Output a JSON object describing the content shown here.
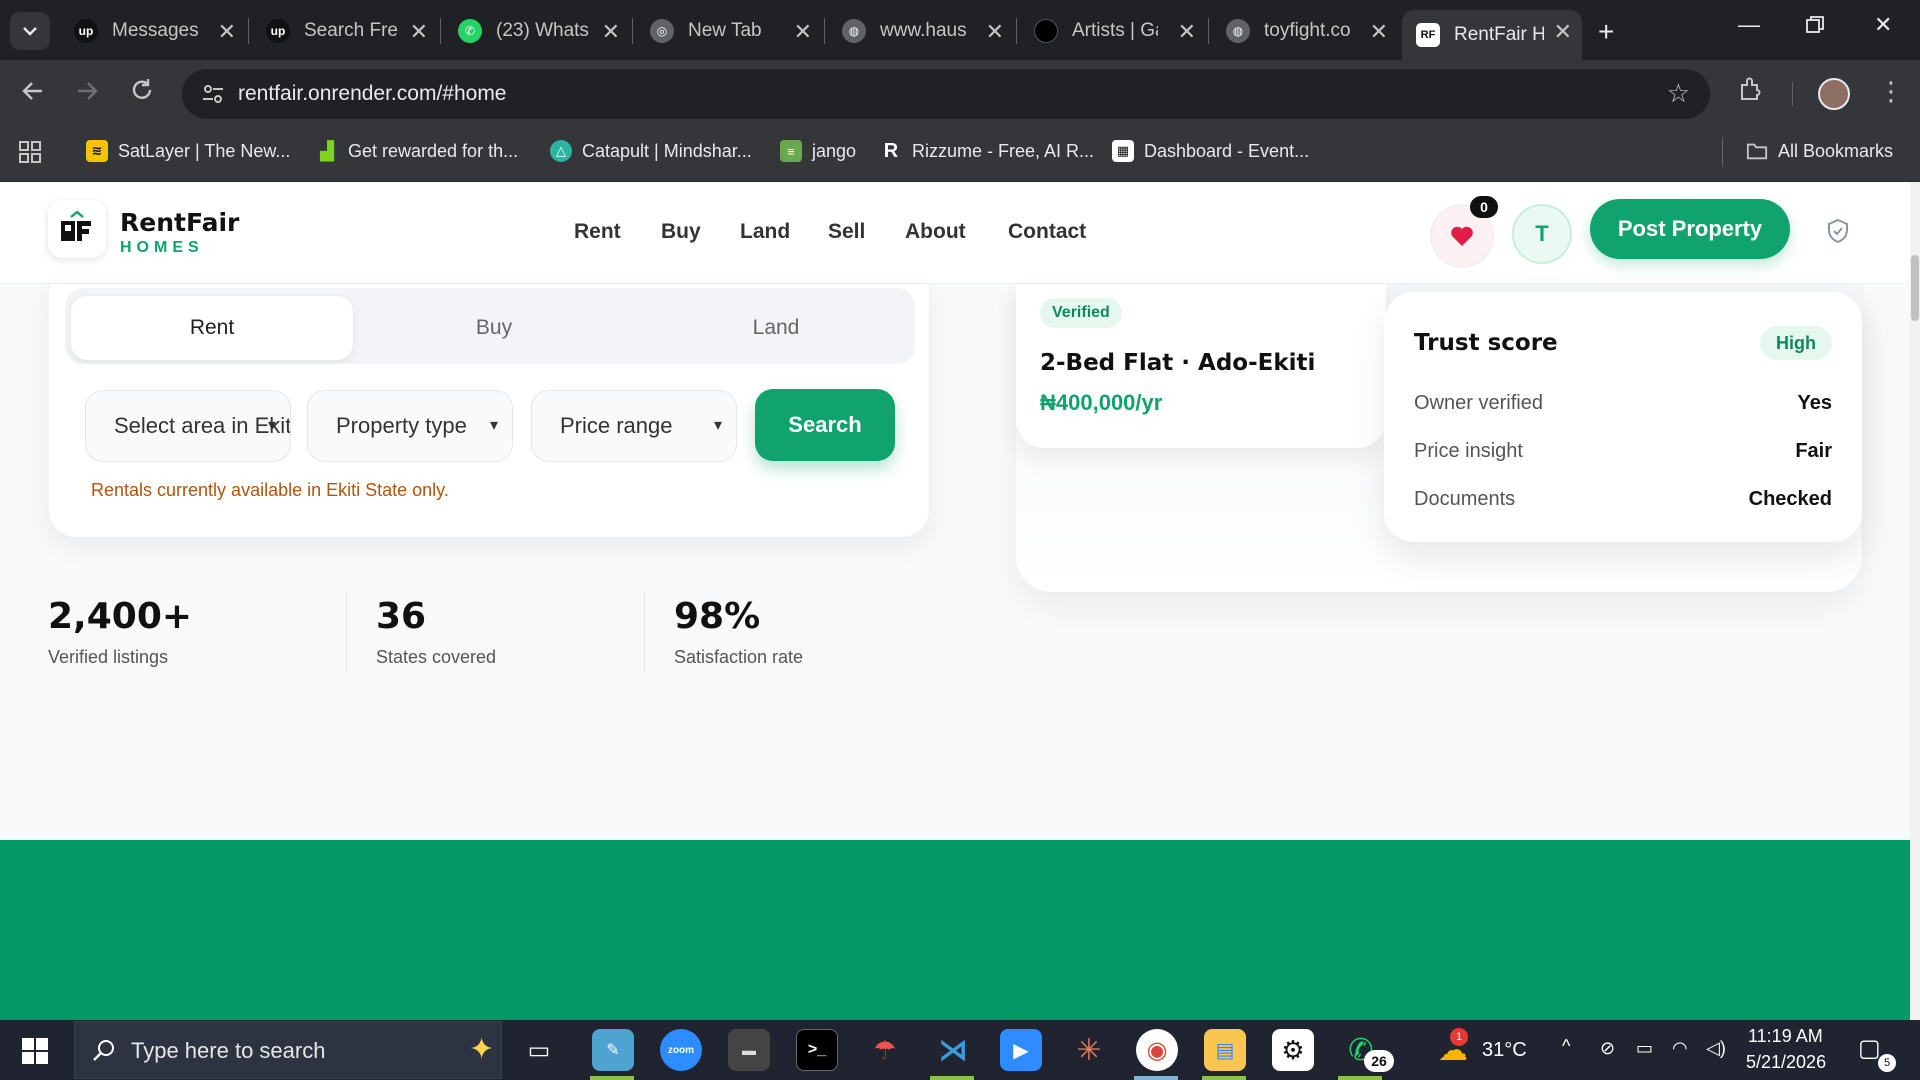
{
  "browser": {
    "tabs": [
      {
        "title": "Messages",
        "icon": "upwork-icon"
      },
      {
        "title": "Search Fre",
        "icon": "upwork-icon"
      },
      {
        "title": "(23) Whats",
        "icon": "whatsapp-icon"
      },
      {
        "title": "New Tab",
        "icon": "chrome-icon"
      },
      {
        "title": "www.haus",
        "icon": "globe-icon"
      },
      {
        "title": "Artists | Ga",
        "icon": "circle-icon"
      },
      {
        "title": "toyfight.co",
        "icon": "globe-icon"
      },
      {
        "title": "RentFair H",
        "icon": "rentfair-icon",
        "active": true
      }
    ],
    "url": "rentfair.onrender.com/#home",
    "bookmarks": [
      {
        "label": "SatLayer | The New...",
        "icon": "satlayer-icon"
      },
      {
        "label": "Get rewarded for th...",
        "icon": "chart-icon"
      },
      {
        "label": "Catapult | Mindshar...",
        "icon": "catapult-icon"
      },
      {
        "label": "jango",
        "icon": "doc-icon"
      },
      {
        "label": "Rizzume - Free, AI R...",
        "icon": "r-icon"
      },
      {
        "label": "Dashboard - Event...",
        "icon": "dashboard-icon"
      }
    ],
    "all_bookmarks": "All Bookmarks"
  },
  "site": {
    "brand": {
      "name": "RentFair",
      "tagline": "HOMES"
    },
    "nav": [
      "Rent",
      "Buy",
      "Land",
      "Sell",
      "About",
      "Contact"
    ],
    "favorites_count": "0",
    "avatar_initial": "T",
    "post_property": "Post Property",
    "colors": {
      "accent": "#10a36e",
      "band": "#049a68",
      "notice": "#b45309"
    }
  },
  "search": {
    "tabs": [
      "Rent",
      "Buy",
      "Land"
    ],
    "active_tab": "Rent",
    "area": "Select area in Ekiti",
    "property_type": "Property type",
    "price_range": "Price range",
    "button": "Search",
    "notice": "Rentals currently available in Ekiti State only."
  },
  "stats": [
    {
      "value": "2,400+",
      "label": "Verified listings"
    },
    {
      "value": "36",
      "label": "States covered"
    },
    {
      "value": "98%",
      "label": "Satisfaction rate"
    }
  ],
  "listing": {
    "badge": "Verified",
    "title": "2-Bed Flat · Ado-Ekiti",
    "price": "₦400,000/yr"
  },
  "trust": {
    "title": "Trust score",
    "level": "High",
    "rows": [
      {
        "label": "Owner verified",
        "value": "Yes"
      },
      {
        "label": "Price insight",
        "value": "Fair"
      },
      {
        "label": "Documents",
        "value": "Checked"
      }
    ]
  },
  "taskbar": {
    "search_placeholder": "Type here to search",
    "weather": "31°C",
    "time": "11:19 AM",
    "date": "5/21/2026",
    "whatsapp_count": "26",
    "weather_badge": "1",
    "notifications": "5"
  }
}
